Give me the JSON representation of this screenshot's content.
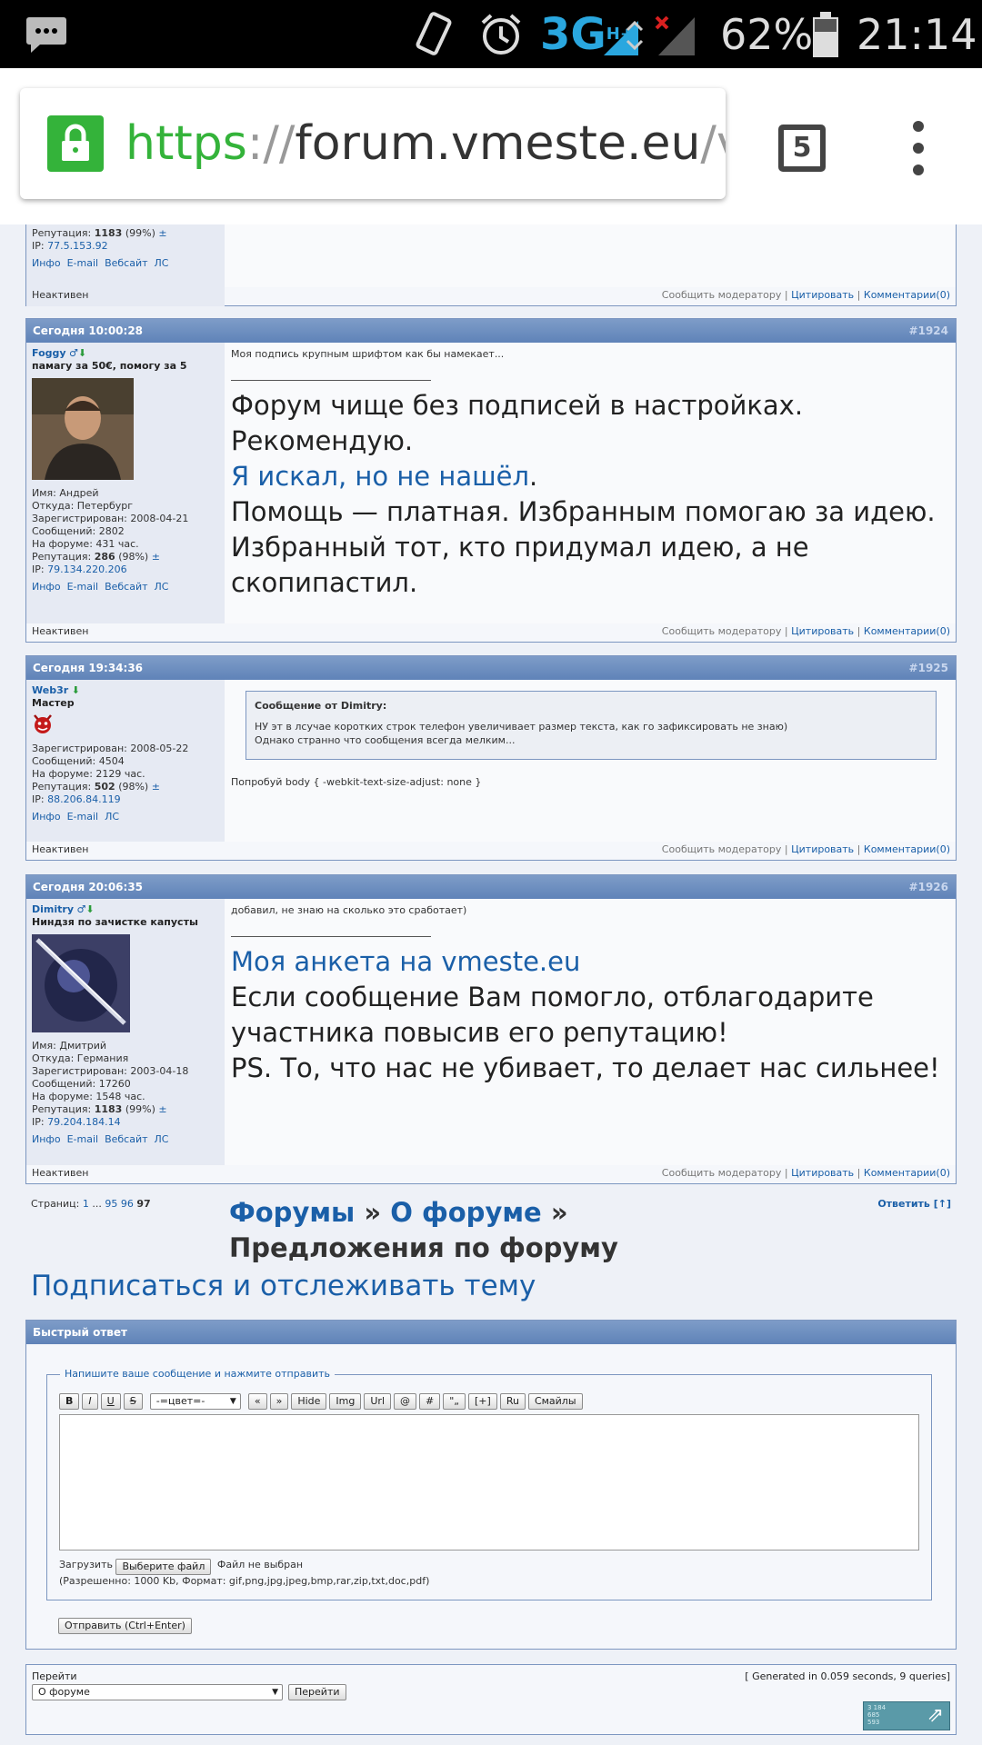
{
  "status_bar": {
    "network": "3G",
    "network_sup": "H+",
    "battery": "62%",
    "time": "21:14"
  },
  "browser": {
    "url_scheme": "https",
    "url_sep": "://",
    "url_host": "forum.vmeste.eu",
    "url_path": "/vie",
    "tab_count": "5"
  },
  "post0": {
    "reputation_label": "Репутация:",
    "reputation": "1183",
    "reputation_pct": "(99%)",
    "pm": "±",
    "ip_label": "IP:",
    "ip": "77.5.153.92",
    "links": [
      "Инфо",
      "E-mail",
      "Вебсайт",
      "ЛС"
    ],
    "status": "Неактивен"
  },
  "footer_links": {
    "report": "Сообщить модератору",
    "sep": "|",
    "quote": "Цитировать",
    "comments": "Комментарии(0)"
  },
  "post1": {
    "date": "Сегодня 10:00:28",
    "num": "#1924",
    "user": "Foggy",
    "title": "памагу за 50€, помогу за 5",
    "info": [
      "Имя: Андрей",
      "Откуда: Петербург",
      "Зарегистрирован: 2008-04-21",
      "Сообщений: 2802",
      "На форуме: 431 час."
    ],
    "reputation_label": "Репутация:",
    "reputation": "286",
    "reputation_pct": "(98%)",
    "pm": "±",
    "ip_label": "IP:",
    "ip": "79.134.220.206",
    "links": [
      "Инфо",
      "E-mail",
      "Вебсайт",
      "ЛС"
    ],
    "status": "Неактивен",
    "text": "Моя подпись крупным шрифтом как бы намекает...",
    "sig1": "Форум чище без подписей в настройках. Рекомендую.",
    "sig_link": "Я искал, но не нашёл",
    "sig_dot": ".",
    "sig2": "Помощь — платная. Избранным помогаю за идею. Избранный тот, кто придумал идею, а не скопипастил."
  },
  "post2": {
    "date": "Сегодня 19:34:36",
    "num": "#1925",
    "user": "Web3r",
    "title": "Мастер",
    "info": [
      "Зарегистрирован: 2008-05-22",
      "Сообщений: 4504",
      "На форуме: 2129 час."
    ],
    "reputation_label": "Репутация:",
    "reputation": "502",
    "reputation_pct": "(98%)",
    "pm": "±",
    "ip_label": "IP:",
    "ip": "88.206.84.119",
    "links": [
      "Инфо",
      "E-mail",
      "ЛС"
    ],
    "status": "Неактивен",
    "quote_title": "Сообщение от Dimitry:",
    "quote_line1": "НУ эт в лсучае коротких строк телефон увеличивает размер текста, как го зафиксировать не знаю)",
    "quote_line2": "Однако странно что сообщения всегда мелким...",
    "text": "Попробуй body { -webkit-text-size-adjust: none }"
  },
  "post3": {
    "date": "Сегодня 20:06:35",
    "num": "#1926",
    "user": "Dimitry",
    "title": "Ниндзя по зачистке капусты",
    "info": [
      "Имя: Дмитрий",
      "Откуда: Германия",
      "Зарегистрирован: 2003-04-18",
      "Сообщений: 17260",
      "На форуме: 1548 час."
    ],
    "reputation_label": "Репутация:",
    "reputation": "1183",
    "reputation_pct": "(99%)",
    "pm": "±",
    "ip_label": "IP:",
    "ip": "79.204.184.14",
    "links": [
      "Инфо",
      "E-mail",
      "Вебсайт",
      "ЛС"
    ],
    "status": "Неактивен",
    "text": "добавил, не знаю на сколько это сработает)",
    "sig_link": "Моя анкета на vmeste.eu",
    "sig_text": "Если сообщение Вам помогло, отблагодарите участника повысив его репутацию!",
    "sig_ps": "PS. То, что нас не убивает, то делает нас сильнее!"
  },
  "pagination": {
    "label": "Страниц:",
    "p1": "1",
    "dots": "...",
    "p95": "95",
    "p96": "96",
    "current": "97"
  },
  "breadcrumb": {
    "forums": "Форумы",
    "sep": "»",
    "about": "О форуме",
    "current": "Предложения по форуму"
  },
  "reply_link": "Ответить [↑]",
  "subscribe": "Подписаться и отслеживать тему",
  "quick_reply": {
    "title": "Быстрый ответ",
    "legend": "Напишите ваше сообщение и нажмите отправить",
    "toolbar": [
      "B",
      "I",
      "U",
      "S"
    ],
    "color_select": "-=цвет=-",
    "toolbar2": [
      "«",
      "»",
      "Hide",
      "Img",
      "Url",
      "@",
      "#",
      "\"„",
      "[+]",
      "Ru",
      "Смайлы"
    ],
    "upload_label": "Загрузить",
    "choose_file": "Выберите файл",
    "no_file": "Файл не выбран",
    "allowed": "(Разрешенно: 1000 Kb, Формат: gif,png,jpg,jpeg,bmp,rar,zip,txt,doc,pdf)",
    "send": "Отправить (Ctrl+Enter)"
  },
  "jump": {
    "label": "Перейти",
    "select_value": "О форуме",
    "button": "Перейти",
    "generated": "[ Generated in 0.059 seconds, 9 queries]"
  },
  "counter": [
    "3 184",
    "685",
    "593"
  ]
}
